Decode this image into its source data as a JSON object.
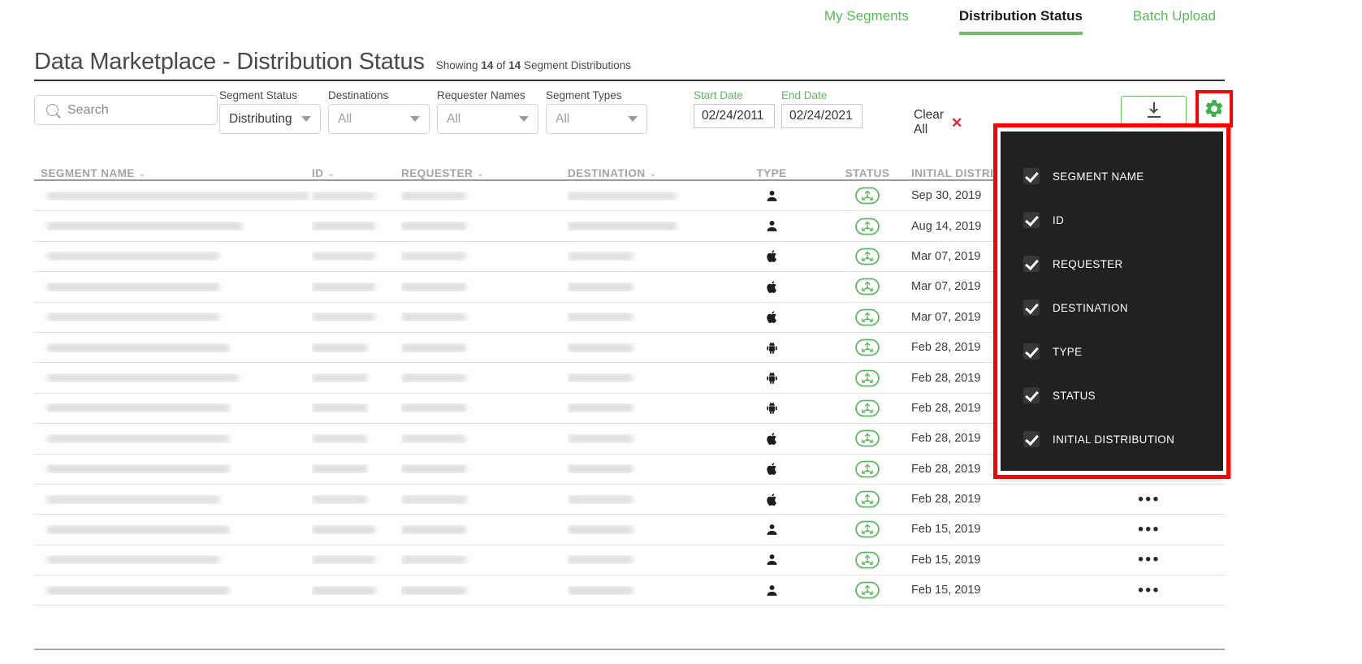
{
  "nav": {
    "items": [
      {
        "label": "My Segments",
        "active": false
      },
      {
        "label": "Distribution Status",
        "active": true
      },
      {
        "label": "Batch Upload",
        "active": false
      }
    ]
  },
  "header": {
    "title": "Data Marketplace - Distribution Status",
    "showing_prefix": "Showing",
    "showing_count": "14",
    "showing_middle": "of",
    "showing_total": "14",
    "showing_suffix": "Segment Distributions"
  },
  "search": {
    "placeholder": "Search",
    "value": "",
    "icon": "search-icon"
  },
  "filters": [
    {
      "label": "Segment Status",
      "value": "Distributing",
      "is_placeholder": false
    },
    {
      "label": "Destinations",
      "value": "All",
      "is_placeholder": true
    },
    {
      "label": "Requester Names",
      "value": "All",
      "is_placeholder": true
    },
    {
      "label": "Segment Types",
      "value": "All",
      "is_placeholder": true
    }
  ],
  "dates": {
    "start_label": "Start Date",
    "start_value": "02/24/2011",
    "end_label": "End Date",
    "end_value": "02/24/2021"
  },
  "clear_all": {
    "label": "Clear All",
    "icon": "close-x-icon"
  },
  "download": {
    "icon": "download-icon",
    "label": ""
  },
  "settings": {
    "icon": "gear-icon",
    "highlight_color": "#ff0000"
  },
  "table": {
    "columns": [
      {
        "key": "name",
        "label": "SEGMENT NAME",
        "sortable": true
      },
      {
        "key": "id",
        "label": "ID",
        "sortable": true
      },
      {
        "key": "requester",
        "label": "REQUESTER",
        "sortable": true
      },
      {
        "key": "destination",
        "label": "DESTINATION",
        "sortable": true
      },
      {
        "key": "type",
        "label": "TYPE",
        "sortable": false
      },
      {
        "key": "status",
        "label": "STATUS",
        "sortable": false
      },
      {
        "key": "initial",
        "label": "INITIAL DISTRIBUTION",
        "sortable": false
      },
      {
        "key": "actions",
        "label": "",
        "sortable": false
      }
    ],
    "rows": [
      {
        "name_w": 322,
        "id_w": 78,
        "req_w": 80,
        "dest_w": 134,
        "type": "person",
        "status": "distributing",
        "initial": "Sep 30, 2019",
        "actions": "•••"
      },
      {
        "name_w": 240,
        "id_w": 78,
        "req_w": 80,
        "dest_w": 134,
        "type": "person",
        "status": "distributing",
        "initial": "Aug 14, 2019",
        "actions": "•••"
      },
      {
        "name_w": 212,
        "id_w": 78,
        "req_w": 80,
        "dest_w": 80,
        "type": "apple",
        "status": "distributing",
        "initial": "Mar 07, 2019",
        "actions": "•••"
      },
      {
        "name_w": 212,
        "id_w": 78,
        "req_w": 80,
        "dest_w": 80,
        "type": "apple",
        "status": "distributing",
        "initial": "Mar 07, 2019",
        "actions": "•••"
      },
      {
        "name_w": 212,
        "id_w": 78,
        "req_w": 80,
        "dest_w": 80,
        "type": "apple",
        "status": "distributing",
        "initial": "Mar 07, 2019",
        "actions": "•••"
      },
      {
        "name_w": 224,
        "id_w": 68,
        "req_w": 80,
        "dest_w": 80,
        "type": "android",
        "status": "distributing",
        "initial": "Feb 28, 2019",
        "actions": "•••"
      },
      {
        "name_w": 236,
        "id_w": 68,
        "req_w": 80,
        "dest_w": 80,
        "type": "android",
        "status": "distributing",
        "initial": "Feb 28, 2019",
        "actions": "•••"
      },
      {
        "name_w": 224,
        "id_w": 68,
        "req_w": 80,
        "dest_w": 80,
        "type": "android",
        "status": "distributing",
        "initial": "Feb 28, 2019",
        "actions": "•••"
      },
      {
        "name_w": 224,
        "id_w": 68,
        "req_w": 80,
        "dest_w": 80,
        "type": "apple",
        "status": "distributing",
        "initial": "Feb 28, 2019",
        "actions": "•••"
      },
      {
        "name_w": 224,
        "id_w": 68,
        "req_w": 80,
        "dest_w": 80,
        "type": "apple",
        "status": "distributing",
        "initial": "Feb 28, 2019",
        "actions": "•••"
      },
      {
        "name_w": 212,
        "id_w": 68,
        "req_w": 80,
        "dest_w": 80,
        "type": "apple",
        "status": "distributing",
        "initial": "Feb 28, 2019",
        "actions": "•••"
      },
      {
        "name_w": 224,
        "id_w": 78,
        "req_w": 80,
        "dest_w": 80,
        "type": "person",
        "status": "distributing",
        "initial": "Feb 15, 2019",
        "actions": "•••"
      },
      {
        "name_w": 212,
        "id_w": 78,
        "req_w": 80,
        "dest_w": 80,
        "type": "person",
        "status": "distributing",
        "initial": "Feb 15, 2019",
        "actions": "•••"
      },
      {
        "name_w": 224,
        "id_w": 78,
        "req_w": 80,
        "dest_w": 80,
        "type": "person",
        "status": "distributing",
        "initial": "Feb 15, 2019",
        "actions": "•••"
      }
    ]
  },
  "column_chooser": {
    "items": [
      {
        "label": "SEGMENT NAME",
        "checked": true
      },
      {
        "label": "ID",
        "checked": true
      },
      {
        "label": "REQUESTER",
        "checked": true
      },
      {
        "label": "DESTINATION",
        "checked": true
      },
      {
        "label": "TYPE",
        "checked": true
      },
      {
        "label": "STATUS",
        "checked": true
      },
      {
        "label": "INITIAL DISTRIBUTION",
        "checked": true
      }
    ]
  },
  "colors": {
    "accent_green": "#5cb85c",
    "highlight_red": "#ff0000",
    "panel_dark": "#212121",
    "header_gray": "#a5a5a5"
  }
}
